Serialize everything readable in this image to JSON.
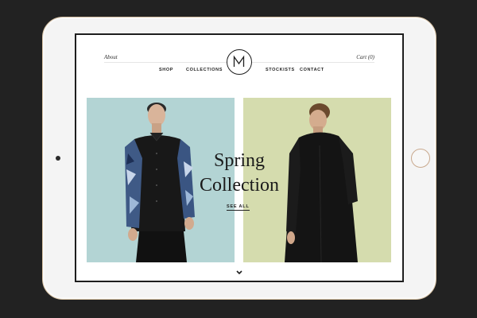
{
  "header": {
    "about_label": "About",
    "cart_label": "Cart (0)",
    "logo_letter": "M"
  },
  "nav": {
    "shop": "SHOP",
    "collections": "COLLECTIONS",
    "stockists": "STOCKISTS",
    "contact": "CONTACT"
  },
  "hero": {
    "title_line1": "Spring",
    "title_line2": "Collection",
    "cta_label": "SEE ALL"
  },
  "colors": {
    "left_panel": "#b3d4d4",
    "right_panel": "#d5dcae",
    "background": "#222222",
    "device_frame": "#f4f4f4"
  },
  "icons": {
    "logo": "monogram-m-logo",
    "scroll": "chevron-down-icon"
  }
}
